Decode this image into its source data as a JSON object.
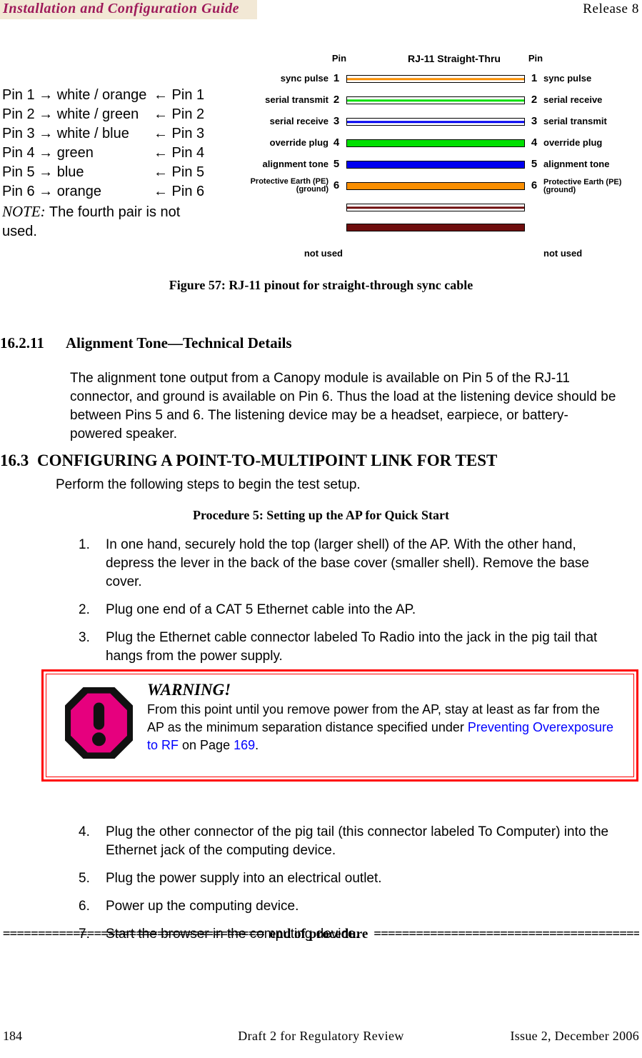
{
  "header": {
    "title": "Installation and Configuration Guide",
    "release": "Release 8",
    "title_bg": "#F2E8D5",
    "title_color": "#9E1A5A"
  },
  "pin_mapping": {
    "rows": [
      {
        "left": "Pin 1 → white / orange",
        "right": "← Pin 1"
      },
      {
        "left": "Pin 2 → white / green",
        "right": "← Pin 2"
      },
      {
        "left": "Pin 3 → white / blue",
        "right": "← Pin 3"
      },
      {
        "left": "Pin 4 → green",
        "right": "← Pin 4"
      },
      {
        "left": "Pin 5 → blue",
        "right": "← Pin 5"
      },
      {
        "left": "Pin 6 → orange",
        "right": "← Pin 6"
      }
    ],
    "note_label": "NOTE:",
    "note_text": " The fourth pair is not used."
  },
  "diagram": {
    "header_pin_left": "Pin",
    "header_title": "RJ-11 Straight-Thru",
    "header_pin_right": "Pin",
    "not_used_left": "not used",
    "not_used_right": "not used",
    "colors": {
      "orange": "#F98E00",
      "green": "#00E000",
      "blue": "#0000F0",
      "brown": "#6E0D0D"
    },
    "wires": [
      {
        "pin": "1",
        "label_left": "sync pulse",
        "label_right": "sync pulse",
        "style": "striped",
        "color": "orange"
      },
      {
        "pin": "2",
        "label_left": "serial transmit",
        "label_right": "serial receive",
        "style": "striped",
        "color": "green"
      },
      {
        "pin": "3",
        "label_left": "serial receive",
        "label_right": "serial transmit",
        "style": "striped",
        "color": "blue"
      },
      {
        "pin": "4",
        "label_left": "override plug",
        "label_right": "override plug",
        "style": "solid",
        "color": "green"
      },
      {
        "pin": "5",
        "label_left": "alignment tone",
        "label_right": "alignment tone",
        "style": "solid",
        "color": "blue"
      },
      {
        "pin": "6",
        "label_left": "Protective Earth (PE) (ground)",
        "label_right": "Protective Earth (PE) (ground)",
        "style": "solid",
        "color": "orange"
      },
      {
        "pin": "",
        "label_left": "",
        "label_right": "",
        "style": "striped",
        "color": "brown"
      },
      {
        "pin": "",
        "label_left": "",
        "label_right": "",
        "style": "solid",
        "color": "brown"
      }
    ]
  },
  "figure": {
    "caption": "Figure 57: RJ-11 pinout for straight-through sync cable"
  },
  "section_16_2_11": {
    "number": "16.2.11",
    "title": "Alignment Tone—Technical Details",
    "paragraph": "The alignment tone output from a Canopy module is available on Pin 5 of the RJ-11 connector, and ground is available on Pin 6. Thus the load at the listening device should be between Pins 5 and 6. The listening device may be a headset, earpiece, or battery-powered speaker."
  },
  "section_16_3": {
    "number": "16.3",
    "title": "CONFIGURING A POINT-TO-MULTIPOINT LINK FOR TEST",
    "lead": "Perform the following steps to begin the test setup.",
    "procedure_title": "Procedure 5: Setting up the AP for Quick Start",
    "steps_before_warning": [
      {
        "num": "1.",
        "text": "In one hand, securely hold the top (larger shell) of the AP. With the other hand, depress the lever in the back of the base cover (smaller shell). Remove the base cover."
      },
      {
        "num": "2.",
        "text": "Plug one end of a CAT 5 Ethernet cable into the AP."
      },
      {
        "num": "3.",
        "text": "Plug the Ethernet cable connector labeled To Radio into the jack in the pig tail that hangs from the power supply."
      }
    ],
    "steps_after_warning": [
      {
        "num": "4.",
        "text": "Plug the other connector of the pig tail (this connector labeled To Computer) into the Ethernet jack of the computing device."
      },
      {
        "num": "5.",
        "text": "Plug the power supply into an electrical outlet."
      },
      {
        "num": "6.",
        "text": "Power up the computing device."
      },
      {
        "num": "7.",
        "text": "Start the browser in the computing device."
      }
    ],
    "end_of_procedure_label": "end of procedure",
    "end_of_procedure_rule": "============================================="
  },
  "warning": {
    "heading": "WARNING!",
    "text_part1": "From this point until you remove power from the AP, stay at least as far from the AP as the minimum separation distance specified under ",
    "link_text": "Preventing Overexposure to RF",
    "text_part2": "  on Page ",
    "page_link": "169",
    "text_part3": ".",
    "border_color": "#FF0000",
    "icon_color": "#E6007E"
  },
  "footer": {
    "page_number": "184",
    "center": "Draft 2 for Regulatory Review",
    "right": "Issue 2, December 2006"
  }
}
